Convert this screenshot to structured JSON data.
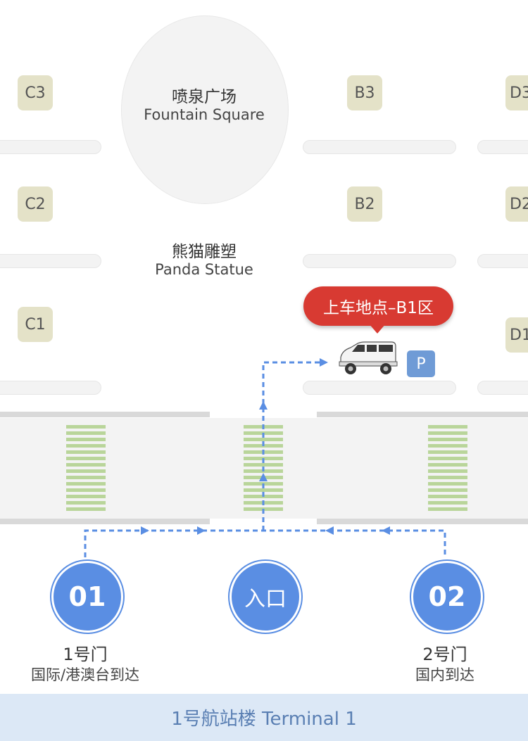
{
  "zones": {
    "c3": "C3",
    "c2": "C2",
    "c1": "C1",
    "b3": "B3",
    "b2": "B2",
    "d3": "D3",
    "d2": "D2",
    "d1": "D1"
  },
  "landmarks": {
    "fountain_cn": "喷泉广场",
    "fountain_en": "Fountain Square",
    "panda_cn": "熊猫雕塑",
    "panda_en": "Panda Statue"
  },
  "pickup": {
    "label": "上车地点–B1区",
    "parking": "P"
  },
  "gates": {
    "gate1": {
      "number": "01",
      "title": "1号门",
      "subtitle": "国际/港澳台到达"
    },
    "entry": {
      "label": "入口"
    },
    "gate2": {
      "number": "02",
      "title": "2号门",
      "subtitle": "国内到达"
    }
  },
  "footer": {
    "label": "1号航站楼 Terminal 1"
  },
  "colors": {
    "route": "#5a8ee3",
    "callout": "#d83a32",
    "gate": "#5a8ee3",
    "zone_tag": "#e4e2c8",
    "crosswalk": "#b9d59a",
    "footer_bg": "#dce8f6"
  }
}
